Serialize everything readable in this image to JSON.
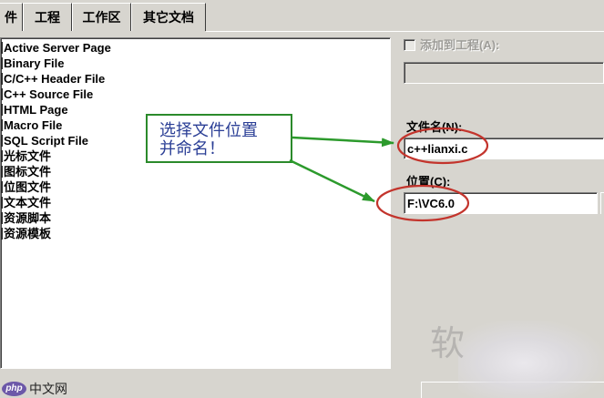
{
  "tabs": [
    {
      "label": "件"
    },
    {
      "label": "工程"
    },
    {
      "label": "工作区"
    },
    {
      "label": "其它文档"
    }
  ],
  "file_types": [
    {
      "label": "Active Server Page"
    },
    {
      "label": "Binary File"
    },
    {
      "label": "C/C++ Header File"
    },
    {
      "label": "C++ Source File"
    },
    {
      "label": "HTML Page"
    },
    {
      "label": "Macro File"
    },
    {
      "label": "SQL Script File"
    },
    {
      "label": "光标文件"
    },
    {
      "label": "图标文件"
    },
    {
      "label": "位图文件"
    },
    {
      "label": "文本文件"
    },
    {
      "label": "资源脚本"
    },
    {
      "label": "资源模板"
    }
  ],
  "add_to_project": {
    "label": "添加到工程(A):",
    "checked": false,
    "enabled": false
  },
  "filename": {
    "label": "文件名(N):",
    "value": "c++lianxi.c"
  },
  "location": {
    "label": "位置(C):",
    "value": "F:\\VC6.0"
  },
  "annotation": {
    "line1": "选择文件位置",
    "line2": "并命名！"
  },
  "watermark": {
    "logo": "php",
    "site": "中文网",
    "mark": "软"
  },
  "icons": {
    "file_type": "file-icon",
    "checkbox": "checkbox-icon",
    "arrow": "arrow-icon"
  },
  "colors": {
    "annotation_border": "#2b8a2b",
    "annotation_text": "#2b3f96",
    "arrow": "#2c9a2c",
    "highlight": "#c3342c",
    "logo": "#6c58a8"
  }
}
